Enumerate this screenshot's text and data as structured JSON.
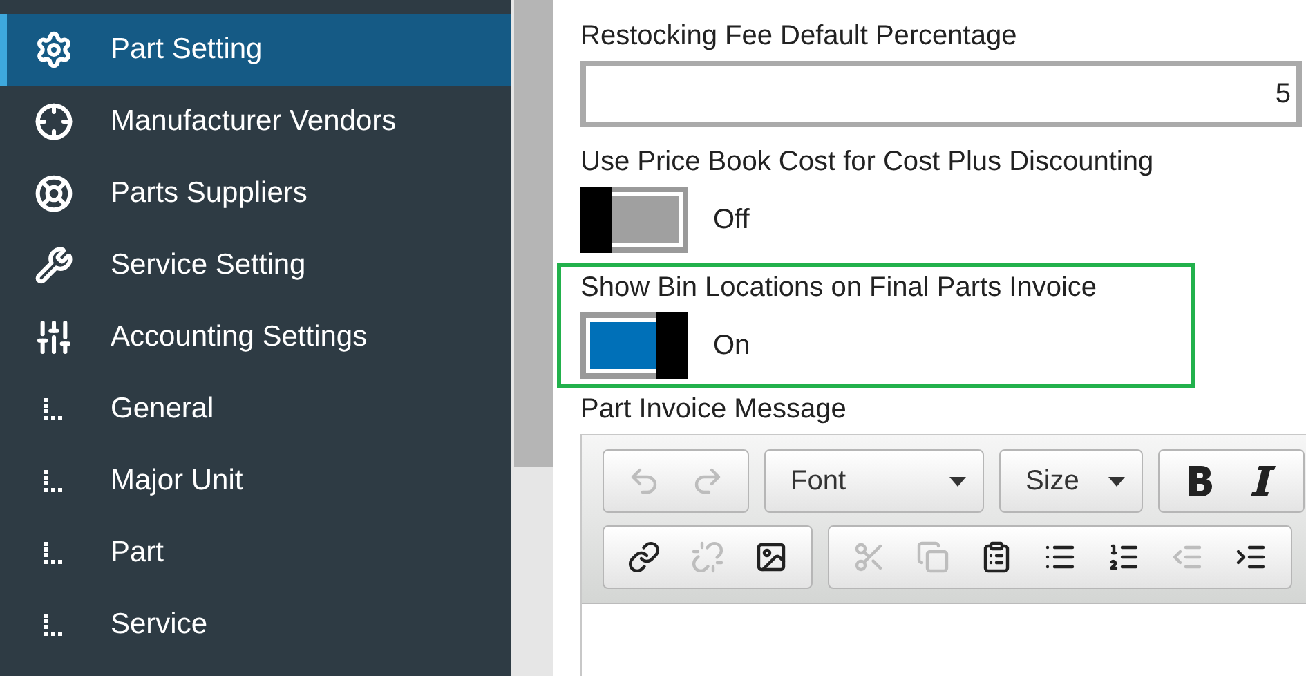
{
  "sidebar": {
    "items": [
      {
        "label": "Part Setting",
        "kind": "gear",
        "selected": true
      },
      {
        "label": "Manufacturer Vendors",
        "kind": "crosshair",
        "selected": false
      },
      {
        "label": "Parts Suppliers",
        "kind": "lifebuoy",
        "selected": false
      },
      {
        "label": "Service Setting",
        "kind": "wrench",
        "selected": false
      },
      {
        "label": "Accounting Settings",
        "kind": "sliders",
        "selected": false
      },
      {
        "label": "General",
        "kind": "tree",
        "selected": false
      },
      {
        "label": "Major Unit",
        "kind": "tree",
        "selected": false
      },
      {
        "label": "Part",
        "kind": "tree",
        "selected": false
      },
      {
        "label": "Service",
        "kind": "tree",
        "selected": false
      }
    ]
  },
  "settings": [
    {
      "kind": "number",
      "label": "Restocking Fee Default Percentage",
      "value": "5",
      "highlighted": false
    },
    {
      "kind": "toggle",
      "label": "Use Price Book Cost for Cost Plus Discounting",
      "on": false,
      "state_text": "Off",
      "highlighted": false
    },
    {
      "kind": "toggle",
      "label": "Show Bin Locations on Final Parts Invoice",
      "on": true,
      "state_text": "On",
      "highlighted": true
    }
  ],
  "editor": {
    "label": "Part Invoice Message",
    "toolbar_rows": [
      [
        [
          {
            "kind": "undo",
            "disabled": true
          },
          {
            "kind": "redo",
            "disabled": true
          }
        ],
        [
          {
            "kind": "dropdown",
            "label": "Font"
          }
        ],
        [
          {
            "kind": "dropdown",
            "label": "Size"
          }
        ],
        [
          {
            "kind": "bold",
            "disabled": false
          },
          {
            "kind": "italic",
            "disabled": false
          }
        ]
      ],
      [
        [
          {
            "kind": "link",
            "disabled": false
          },
          {
            "kind": "unlink",
            "disabled": true
          },
          {
            "kind": "image",
            "disabled": false
          }
        ],
        [
          {
            "kind": "cut",
            "disabled": true
          },
          {
            "kind": "copy",
            "disabled": true
          },
          {
            "kind": "paste",
            "disabled": false
          },
          {
            "kind": "bullets",
            "disabled": false
          },
          {
            "kind": "numbers",
            "disabled": false
          },
          {
            "kind": "outdent",
            "disabled": true
          },
          {
            "kind": "indent",
            "disabled": false
          }
        ]
      ]
    ]
  }
}
